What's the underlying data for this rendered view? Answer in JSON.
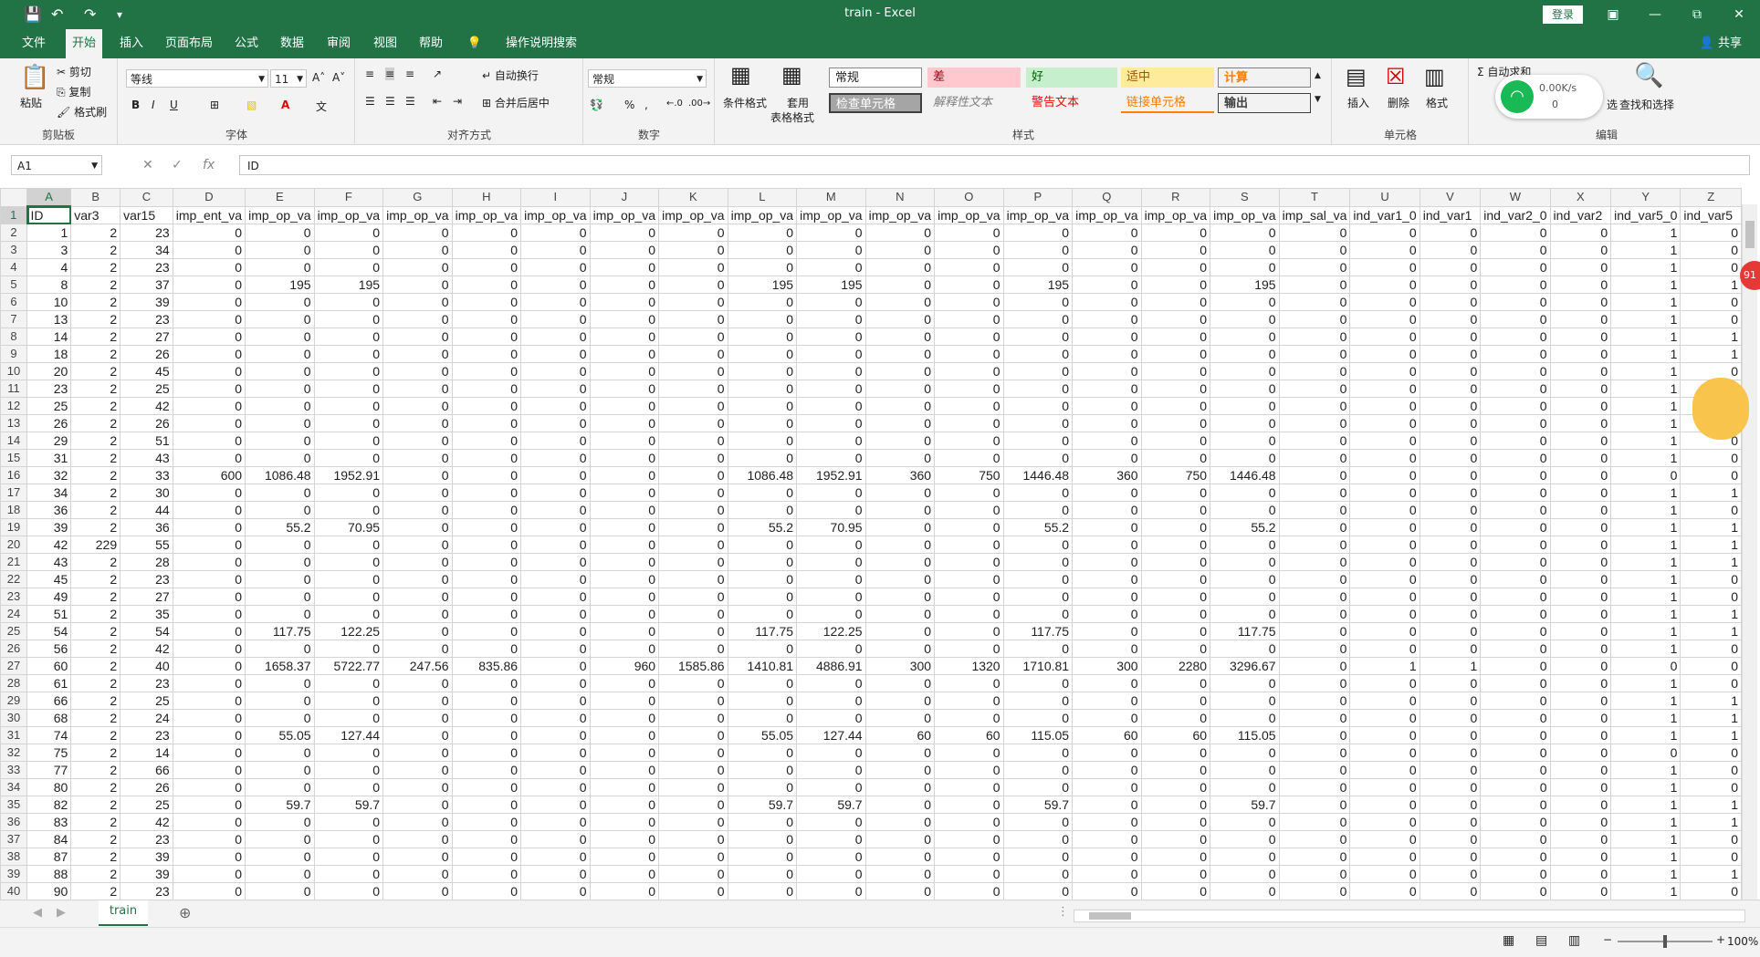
{
  "window": {
    "title": "train - Excel",
    "login_label": "登录",
    "quick_access": [
      "save-icon",
      "undo-icon",
      "redo-icon",
      "customize-icon"
    ]
  },
  "menu": {
    "tabs": [
      "文件",
      "开始",
      "插入",
      "页面布局",
      "公式",
      "数据",
      "审阅",
      "视图",
      "帮助",
      "操作说明搜索"
    ],
    "active": "开始",
    "share_label": "共享"
  },
  "ribbon": {
    "clipboard": {
      "paste": "粘贴",
      "cut": "剪切",
      "copy": "复制",
      "format_painter": "格式刷",
      "label": "剪贴板"
    },
    "font": {
      "name": "等线",
      "size": "11",
      "bold": "B",
      "italic": "I",
      "underline": "U",
      "label": "字体"
    },
    "alignment": {
      "wrap": "自动换行",
      "merge": "合并后居中",
      "label": "对齐方式"
    },
    "number": {
      "format": "常规",
      "percent": "%",
      "comma": ",",
      "label": "数字"
    },
    "styles": {
      "conditional": "条件格式",
      "table_format_1": "套用",
      "table_format_2": "表格格式",
      "items": [
        "常规",
        "差",
        "好",
        "适中",
        "计算",
        "检查单元格",
        "解释性文本",
        "警告文本",
        "链接单元格",
        "输出"
      ],
      "label": "样式"
    },
    "cells": {
      "insert": "插入",
      "delete": "删除",
      "format": "格式",
      "label": "单元格"
    },
    "editing": {
      "autosum": "自动求和",
      "find": "查找和选择",
      "sort_partial": "选",
      "label": "编辑"
    }
  },
  "formula_bar": {
    "name_box": "A1",
    "cancel": "✕",
    "enter": "✓",
    "fx": "fx",
    "value": "ID"
  },
  "sheet": {
    "columns": [
      "A",
      "B",
      "C",
      "D",
      "E",
      "F",
      "G",
      "H",
      "I",
      "J",
      "K",
      "L",
      "M",
      "N",
      "O",
      "P",
      "Q",
      "R",
      "S",
      "T",
      "U",
      "V",
      "W",
      "X",
      "Y",
      "Z"
    ],
    "headers": [
      "ID",
      "var3",
      "var15",
      "imp_ent_va",
      "imp_op_va",
      "imp_op_va",
      "imp_op_va",
      "imp_op_va",
      "imp_op_va",
      "imp_op_va",
      "imp_op_va",
      "imp_op_va",
      "imp_op_va",
      "imp_op_va",
      "imp_op_va",
      "imp_op_va",
      "imp_op_va",
      "imp_op_va",
      "imp_op_va",
      "imp_sal_va",
      "ind_var1_0",
      "ind_var1",
      "ind_var2_0",
      "ind_var2",
      "ind_var5_0",
      "ind_var5"
    ],
    "rows": [
      [
        "1",
        "2",
        "23",
        "0",
        "0",
        "0",
        "0",
        "0",
        "0",
        "0",
        "0",
        "0",
        "0",
        "0",
        "0",
        "0",
        "0",
        "0",
        "0",
        "0",
        "0",
        "0",
        "0",
        "0",
        "1",
        "0"
      ],
      [
        "3",
        "2",
        "34",
        "0",
        "0",
        "0",
        "0",
        "0",
        "0",
        "0",
        "0",
        "0",
        "0",
        "0",
        "0",
        "0",
        "0",
        "0",
        "0",
        "0",
        "0",
        "0",
        "0",
        "0",
        "1",
        "0"
      ],
      [
        "4",
        "2",
        "23",
        "0",
        "0",
        "0",
        "0",
        "0",
        "0",
        "0",
        "0",
        "0",
        "0",
        "0",
        "0",
        "0",
        "0",
        "0",
        "0",
        "0",
        "0",
        "0",
        "0",
        "0",
        "1",
        "0"
      ],
      [
        "8",
        "2",
        "37",
        "0",
        "195",
        "195",
        "0",
        "0",
        "0",
        "0",
        "0",
        "195",
        "195",
        "0",
        "0",
        "195",
        "0",
        "0",
        "195",
        "0",
        "0",
        "0",
        "0",
        "0",
        "1",
        "1"
      ],
      [
        "10",
        "2",
        "39",
        "0",
        "0",
        "0",
        "0",
        "0",
        "0",
        "0",
        "0",
        "0",
        "0",
        "0",
        "0",
        "0",
        "0",
        "0",
        "0",
        "0",
        "0",
        "0",
        "0",
        "0",
        "1",
        "0"
      ],
      [
        "13",
        "2",
        "23",
        "0",
        "0",
        "0",
        "0",
        "0",
        "0",
        "0",
        "0",
        "0",
        "0",
        "0",
        "0",
        "0",
        "0",
        "0",
        "0",
        "0",
        "0",
        "0",
        "0",
        "0",
        "1",
        "0"
      ],
      [
        "14",
        "2",
        "27",
        "0",
        "0",
        "0",
        "0",
        "0",
        "0",
        "0",
        "0",
        "0",
        "0",
        "0",
        "0",
        "0",
        "0",
        "0",
        "0",
        "0",
        "0",
        "0",
        "0",
        "0",
        "1",
        "1"
      ],
      [
        "18",
        "2",
        "26",
        "0",
        "0",
        "0",
        "0",
        "0",
        "0",
        "0",
        "0",
        "0",
        "0",
        "0",
        "0",
        "0",
        "0",
        "0",
        "0",
        "0",
        "0",
        "0",
        "0",
        "0",
        "1",
        "1"
      ],
      [
        "20",
        "2",
        "45",
        "0",
        "0",
        "0",
        "0",
        "0",
        "0",
        "0",
        "0",
        "0",
        "0",
        "0",
        "0",
        "0",
        "0",
        "0",
        "0",
        "0",
        "0",
        "0",
        "0",
        "0",
        "1",
        "0"
      ],
      [
        "23",
        "2",
        "25",
        "0",
        "0",
        "0",
        "0",
        "0",
        "0",
        "0",
        "0",
        "0",
        "0",
        "0",
        "0",
        "0",
        "0",
        "0",
        "0",
        "0",
        "0",
        "0",
        "0",
        "0",
        "1",
        "0"
      ],
      [
        "25",
        "2",
        "42",
        "0",
        "0",
        "0",
        "0",
        "0",
        "0",
        "0",
        "0",
        "0",
        "0",
        "0",
        "0",
        "0",
        "0",
        "0",
        "0",
        "0",
        "0",
        "0",
        "0",
        "0",
        "1",
        "0"
      ],
      [
        "26",
        "2",
        "26",
        "0",
        "0",
        "0",
        "0",
        "0",
        "0",
        "0",
        "0",
        "0",
        "0",
        "0",
        "0",
        "0",
        "0",
        "0",
        "0",
        "0",
        "0",
        "0",
        "0",
        "0",
        "1",
        "0"
      ],
      [
        "29",
        "2",
        "51",
        "0",
        "0",
        "0",
        "0",
        "0",
        "0",
        "0",
        "0",
        "0",
        "0",
        "0",
        "0",
        "0",
        "0",
        "0",
        "0",
        "0",
        "0",
        "0",
        "0",
        "0",
        "1",
        "0"
      ],
      [
        "31",
        "2",
        "43",
        "0",
        "0",
        "0",
        "0",
        "0",
        "0",
        "0",
        "0",
        "0",
        "0",
        "0",
        "0",
        "0",
        "0",
        "0",
        "0",
        "0",
        "0",
        "0",
        "0",
        "0",
        "1",
        "0"
      ],
      [
        "32",
        "2",
        "33",
        "600",
        "1086.48",
        "1952.91",
        "0",
        "0",
        "0",
        "0",
        "0",
        "1086.48",
        "1952.91",
        "360",
        "750",
        "1446.48",
        "360",
        "750",
        "1446.48",
        "0",
        "0",
        "0",
        "0",
        "0",
        "0",
        "0"
      ],
      [
        "34",
        "2",
        "30",
        "0",
        "0",
        "0",
        "0",
        "0",
        "0",
        "0",
        "0",
        "0",
        "0",
        "0",
        "0",
        "0",
        "0",
        "0",
        "0",
        "0",
        "0",
        "0",
        "0",
        "0",
        "1",
        "1"
      ],
      [
        "36",
        "2",
        "44",
        "0",
        "0",
        "0",
        "0",
        "0",
        "0",
        "0",
        "0",
        "0",
        "0",
        "0",
        "0",
        "0",
        "0",
        "0",
        "0",
        "0",
        "0",
        "0",
        "0",
        "0",
        "1",
        "0"
      ],
      [
        "39",
        "2",
        "36",
        "0",
        "55.2",
        "70.95",
        "0",
        "0",
        "0",
        "0",
        "0",
        "55.2",
        "70.95",
        "0",
        "0",
        "55.2",
        "0",
        "0",
        "55.2",
        "0",
        "0",
        "0",
        "0",
        "0",
        "1",
        "1"
      ],
      [
        "42",
        "229",
        "55",
        "0",
        "0",
        "0",
        "0",
        "0",
        "0",
        "0",
        "0",
        "0",
        "0",
        "0",
        "0",
        "0",
        "0",
        "0",
        "0",
        "0",
        "0",
        "0",
        "0",
        "0",
        "1",
        "1"
      ],
      [
        "43",
        "2",
        "28",
        "0",
        "0",
        "0",
        "0",
        "0",
        "0",
        "0",
        "0",
        "0",
        "0",
        "0",
        "0",
        "0",
        "0",
        "0",
        "0",
        "0",
        "0",
        "0",
        "0",
        "0",
        "1",
        "1"
      ],
      [
        "45",
        "2",
        "23",
        "0",
        "0",
        "0",
        "0",
        "0",
        "0",
        "0",
        "0",
        "0",
        "0",
        "0",
        "0",
        "0",
        "0",
        "0",
        "0",
        "0",
        "0",
        "0",
        "0",
        "0",
        "1",
        "0"
      ],
      [
        "49",
        "2",
        "27",
        "0",
        "0",
        "0",
        "0",
        "0",
        "0",
        "0",
        "0",
        "0",
        "0",
        "0",
        "0",
        "0",
        "0",
        "0",
        "0",
        "0",
        "0",
        "0",
        "0",
        "0",
        "1",
        "0"
      ],
      [
        "51",
        "2",
        "35",
        "0",
        "0",
        "0",
        "0",
        "0",
        "0",
        "0",
        "0",
        "0",
        "0",
        "0",
        "0",
        "0",
        "0",
        "0",
        "0",
        "0",
        "0",
        "0",
        "0",
        "0",
        "1",
        "1"
      ],
      [
        "54",
        "2",
        "54",
        "0",
        "117.75",
        "122.25",
        "0",
        "0",
        "0",
        "0",
        "0",
        "117.75",
        "122.25",
        "0",
        "0",
        "117.75",
        "0",
        "0",
        "117.75",
        "0",
        "0",
        "0",
        "0",
        "0",
        "1",
        "1"
      ],
      [
        "56",
        "2",
        "42",
        "0",
        "0",
        "0",
        "0",
        "0",
        "0",
        "0",
        "0",
        "0",
        "0",
        "0",
        "0",
        "0",
        "0",
        "0",
        "0",
        "0",
        "0",
        "0",
        "0",
        "0",
        "1",
        "0"
      ],
      [
        "60",
        "2",
        "40",
        "0",
        "1658.37",
        "5722.77",
        "247.56",
        "835.86",
        "0",
        "960",
        "1585.86",
        "1410.81",
        "4886.91",
        "300",
        "1320",
        "1710.81",
        "300",
        "2280",
        "3296.67",
        "0",
        "1",
        "1",
        "0",
        "0",
        "0",
        "0"
      ],
      [
        "61",
        "2",
        "23",
        "0",
        "0",
        "0",
        "0",
        "0",
        "0",
        "0",
        "0",
        "0",
        "0",
        "0",
        "0",
        "0",
        "0",
        "0",
        "0",
        "0",
        "0",
        "0",
        "0",
        "0",
        "1",
        "0"
      ],
      [
        "66",
        "2",
        "25",
        "0",
        "0",
        "0",
        "0",
        "0",
        "0",
        "0",
        "0",
        "0",
        "0",
        "0",
        "0",
        "0",
        "0",
        "0",
        "0",
        "0",
        "0",
        "0",
        "0",
        "0",
        "1",
        "1"
      ],
      [
        "68",
        "2",
        "24",
        "0",
        "0",
        "0",
        "0",
        "0",
        "0",
        "0",
        "0",
        "0",
        "0",
        "0",
        "0",
        "0",
        "0",
        "0",
        "0",
        "0",
        "0",
        "0",
        "0",
        "0",
        "1",
        "1"
      ],
      [
        "74",
        "2",
        "23",
        "0",
        "55.05",
        "127.44",
        "0",
        "0",
        "0",
        "0",
        "0",
        "55.05",
        "127.44",
        "60",
        "60",
        "115.05",
        "60",
        "60",
        "115.05",
        "0",
        "0",
        "0",
        "0",
        "0",
        "1",
        "1"
      ],
      [
        "75",
        "2",
        "14",
        "0",
        "0",
        "0",
        "0",
        "0",
        "0",
        "0",
        "0",
        "0",
        "0",
        "0",
        "0",
        "0",
        "0",
        "0",
        "0",
        "0",
        "0",
        "0",
        "0",
        "0",
        "0",
        "0"
      ],
      [
        "77",
        "2",
        "66",
        "0",
        "0",
        "0",
        "0",
        "0",
        "0",
        "0",
        "0",
        "0",
        "0",
        "0",
        "0",
        "0",
        "0",
        "0",
        "0",
        "0",
        "0",
        "0",
        "0",
        "0",
        "1",
        "0"
      ],
      [
        "80",
        "2",
        "26",
        "0",
        "0",
        "0",
        "0",
        "0",
        "0",
        "0",
        "0",
        "0",
        "0",
        "0",
        "0",
        "0",
        "0",
        "0",
        "0",
        "0",
        "0",
        "0",
        "0",
        "0",
        "1",
        "0"
      ],
      [
        "82",
        "2",
        "25",
        "0",
        "59.7",
        "59.7",
        "0",
        "0",
        "0",
        "0",
        "0",
        "59.7",
        "59.7",
        "0",
        "0",
        "59.7",
        "0",
        "0",
        "59.7",
        "0",
        "0",
        "0",
        "0",
        "0",
        "1",
        "1"
      ],
      [
        "83",
        "2",
        "42",
        "0",
        "0",
        "0",
        "0",
        "0",
        "0",
        "0",
        "0",
        "0",
        "0",
        "0",
        "0",
        "0",
        "0",
        "0",
        "0",
        "0",
        "0",
        "0",
        "0",
        "0",
        "1",
        "1"
      ],
      [
        "84",
        "2",
        "23",
        "0",
        "0",
        "0",
        "0",
        "0",
        "0",
        "0",
        "0",
        "0",
        "0",
        "0",
        "0",
        "0",
        "0",
        "0",
        "0",
        "0",
        "0",
        "0",
        "0",
        "0",
        "1",
        "0"
      ],
      [
        "87",
        "2",
        "39",
        "0",
        "0",
        "0",
        "0",
        "0",
        "0",
        "0",
        "0",
        "0",
        "0",
        "0",
        "0",
        "0",
        "0",
        "0",
        "0",
        "0",
        "0",
        "0",
        "0",
        "0",
        "1",
        "0"
      ],
      [
        "88",
        "2",
        "39",
        "0",
        "0",
        "0",
        "0",
        "0",
        "0",
        "0",
        "0",
        "0",
        "0",
        "0",
        "0",
        "0",
        "0",
        "0",
        "0",
        "0",
        "0",
        "0",
        "0",
        "0",
        "1",
        "1"
      ],
      [
        "90",
        "2",
        "23",
        "0",
        "0",
        "0",
        "0",
        "0",
        "0",
        "0",
        "0",
        "0",
        "0",
        "0",
        "0",
        "0",
        "0",
        "0",
        "0",
        "0",
        "0",
        "0",
        "0",
        "0",
        "1",
        "0"
      ]
    ]
  },
  "sheet_tabs": [
    "train"
  ],
  "status": {
    "zoom": "100%"
  },
  "overlays": {
    "net_speed": "0.00K/s",
    "net_count": "0",
    "badge": "91"
  },
  "colors": {
    "accent": "#217346"
  }
}
